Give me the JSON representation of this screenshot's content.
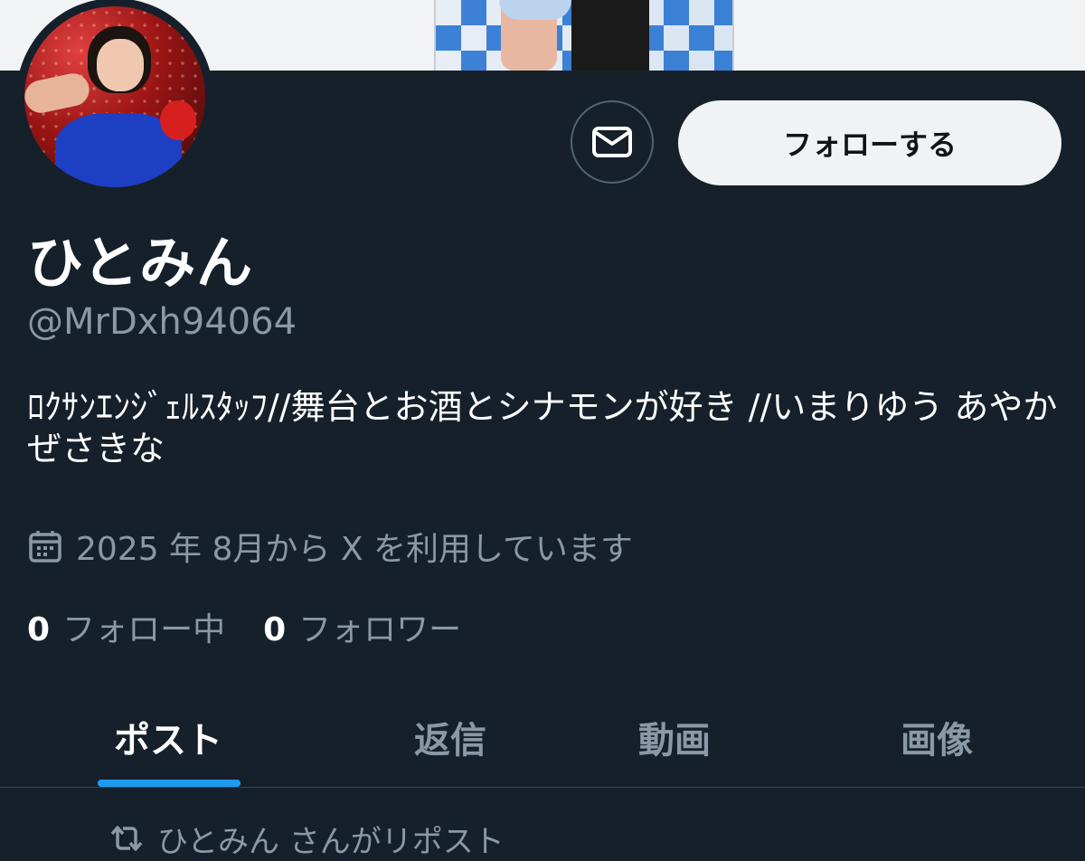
{
  "profile": {
    "display_name": "ひとみん",
    "handle": "@MrDxh94064",
    "bio": "ﾛｸｻﾝｴﾝｼﾞｪﾙｽﾀｯﾌ//舞台とお酒とシナモンが好き //いまりゆう あやかぜさきな",
    "joined": "2025 年 8月から X を利用しています",
    "avatar_icon": "profile-photo",
    "banner_icon": "header-photo"
  },
  "actions": {
    "message_icon": "envelope-icon",
    "follow_label": "フォローする"
  },
  "stats": {
    "following_count": "0",
    "following_label": "フォロー中",
    "followers_count": "0",
    "followers_label": "フォロワー"
  },
  "tabs": [
    {
      "label": "ポスト",
      "active": true
    },
    {
      "label": "返信",
      "active": false
    },
    {
      "label": "動画",
      "active": false
    },
    {
      "label": "画像",
      "active": false
    }
  ],
  "timeline": {
    "repost_text": "ひとみん さんがリポスト",
    "repost_icon": "repost-icon"
  },
  "colors": {
    "background": "#15202b",
    "accent": "#1d9bf0",
    "secondary_text": "#8b98a5",
    "follow_button_bg": "#eff3f4"
  }
}
